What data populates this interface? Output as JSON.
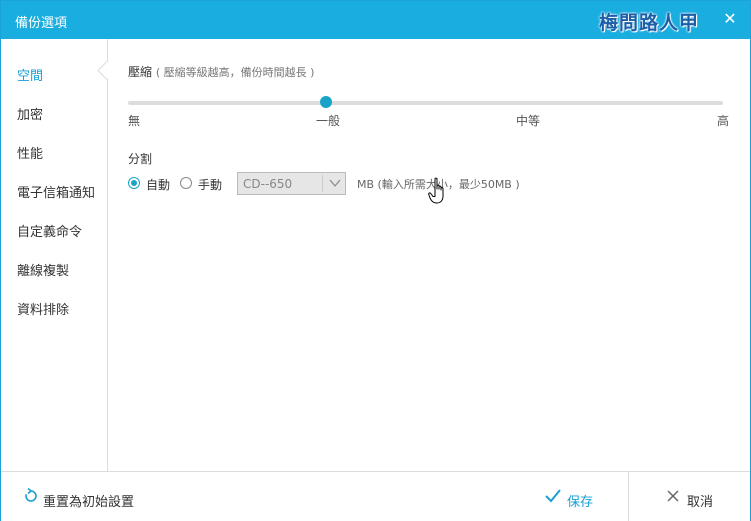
{
  "window": {
    "title": "備份選項",
    "watermark": "梅問路人甲",
    "close_glyph": "✕"
  },
  "sidebar": {
    "items": [
      {
        "label": "空間",
        "active": true
      },
      {
        "label": "加密"
      },
      {
        "label": "性能"
      },
      {
        "label": "電子信箱通知"
      },
      {
        "label": "自定義命令"
      },
      {
        "label": "離線複製"
      },
      {
        "label": "資料排除"
      }
    ]
  },
  "compression": {
    "label": "壓縮",
    "hint": "( 壓縮等級越高，備份時間越長 )",
    "levels": [
      "無",
      "一般",
      "中等",
      "高"
    ],
    "selected": "一般",
    "value_fraction": 0.333
  },
  "split": {
    "label": "分割",
    "options": [
      {
        "label": "自動",
        "checked": true
      },
      {
        "label": "手動",
        "checked": false
      }
    ],
    "select_value": "CD--650",
    "unit_hint": "MB (輸入所需大小，最少50MB )"
  },
  "footer": {
    "reset_label": "重置為初始設置",
    "save_label": "保存",
    "cancel_label": "取消"
  },
  "colors": {
    "accent": "#1aaddf",
    "slider": "#1aa3c8",
    "active_text": "#1a9fd4"
  },
  "icons": {
    "close": "close-icon",
    "reset": "reset-icon",
    "save": "checkmark-icon",
    "cancel": "close-icon",
    "dropdown": "chevron-down-icon",
    "cursor": "hand-cursor-icon"
  }
}
